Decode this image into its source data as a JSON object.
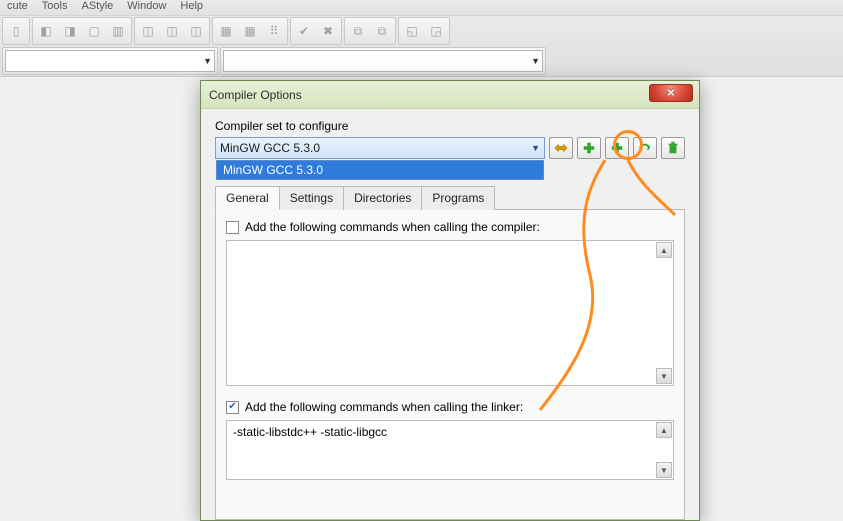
{
  "menu": {
    "items": [
      "cute",
      "Tools",
      "AStyle",
      "Window",
      "Help"
    ]
  },
  "dialog": {
    "title": "Compiler Options",
    "config_label": "Compiler set to configure",
    "selected_compiler": "MinGW GCC 5.3.0",
    "dropdown_option": "MinGW GCC 5.3.0",
    "tabs": [
      "General",
      "Settings",
      "Directories",
      "Programs"
    ],
    "compiler_check_label": "Add the following commands when calling the compiler:",
    "linker_check_label": "Add the following commands when calling the linker:",
    "compiler_commands": "",
    "linker_commands": "-static-libstdc++ -static-libgcc",
    "compiler_checked": false,
    "linker_checked": true
  }
}
